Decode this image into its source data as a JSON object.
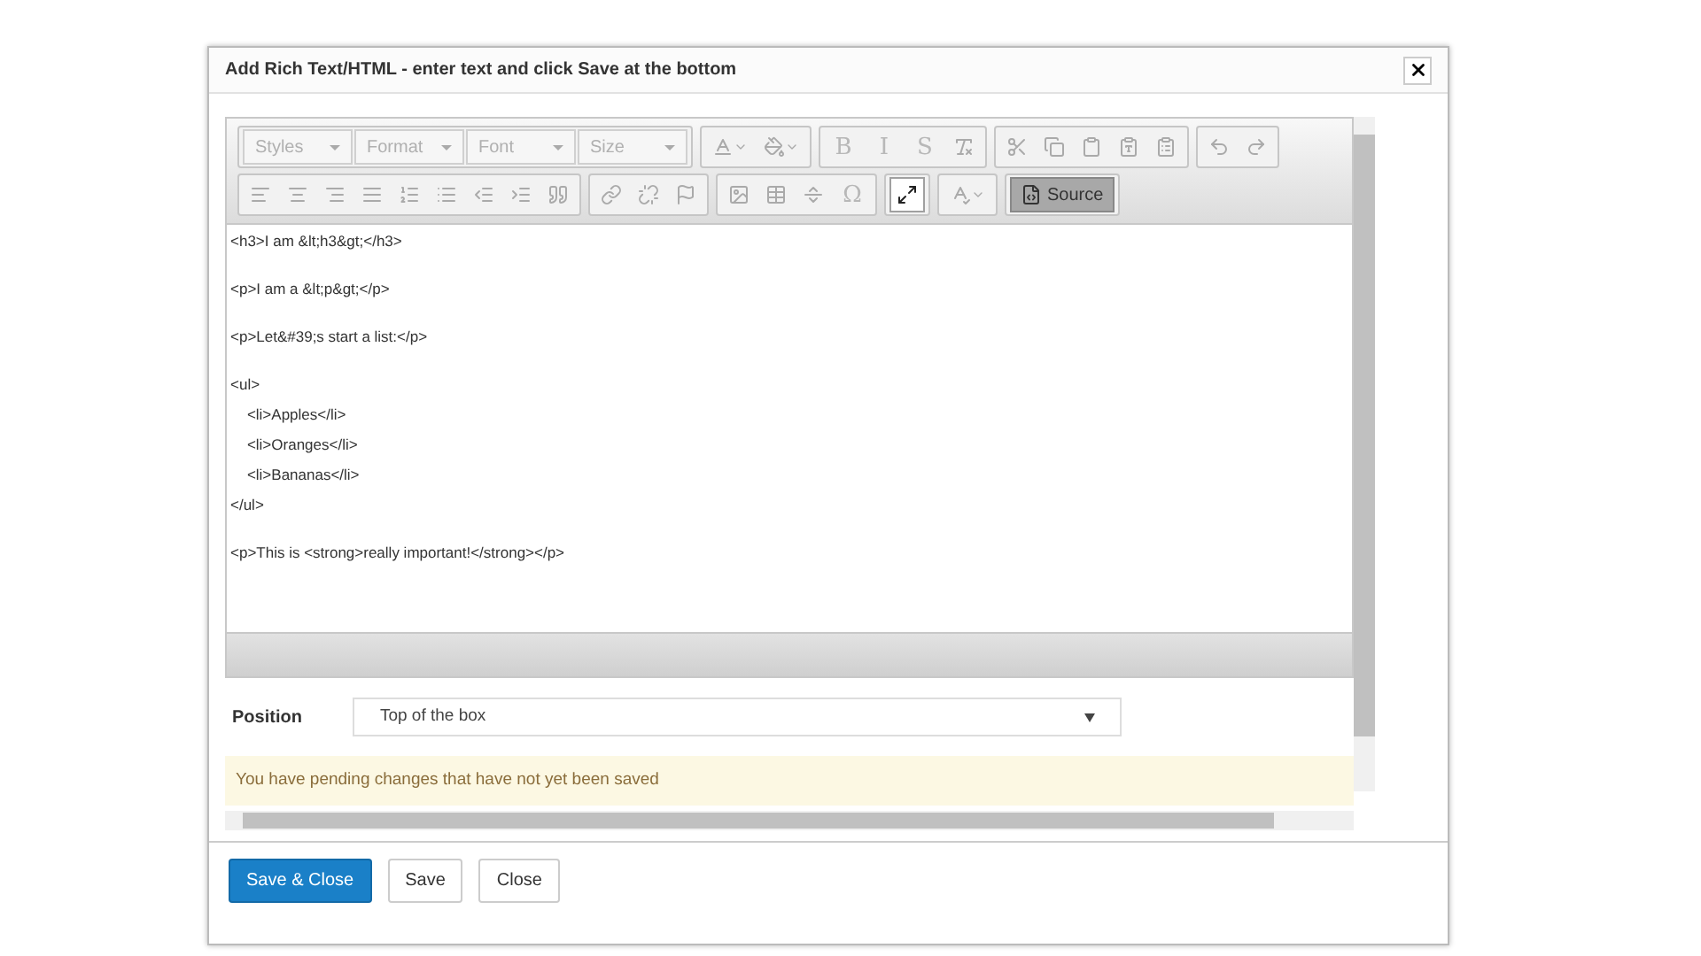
{
  "dialog": {
    "title": "Add Rich Text/HTML - enter text and click Save at the bottom"
  },
  "toolbar": {
    "rows": [
      [
        [
          {
            "kind": "combo",
            "label": "Styles"
          },
          {
            "kind": "combo",
            "label": "Format"
          },
          {
            "kind": "combo",
            "label": "Font"
          },
          {
            "kind": "combo",
            "label": "Size"
          }
        ],
        [
          {
            "kind": "icon",
            "on": false
          },
          {
            "kind": "icon",
            "on": false
          }
        ],
        [
          {
            "kind": "text",
            "label": "B",
            "on": false
          },
          {
            "kind": "text",
            "label": "I",
            "on": false
          },
          {
            "kind": "text",
            "label": "S",
            "on": false
          },
          {
            "kind": "icon",
            "on": false
          }
        ],
        [
          {
            "kind": "icon",
            "on": false
          },
          {
            "kind": "icon",
            "on": false
          },
          {
            "kind": "icon",
            "on": false
          },
          {
            "kind": "icon",
            "on": false
          },
          {
            "kind": "icon",
            "on": false
          }
        ],
        [
          {
            "kind": "icon",
            "on": false
          },
          {
            "kind": "icon",
            "on": false
          }
        ]
      ],
      [
        [
          {
            "kind": "icon",
            "on": false
          },
          {
            "kind": "icon",
            "on": false
          },
          {
            "kind": "icon",
            "on": false
          },
          {
            "kind": "icon",
            "on": false
          },
          {
            "kind": "icon",
            "on": false
          },
          {
            "kind": "icon",
            "on": false
          },
          {
            "kind": "icon",
            "on": false
          },
          {
            "kind": "icon",
            "on": false
          },
          {
            "kind": "icon",
            "on": false
          }
        ],
        [
          {
            "kind": "icon",
            "on": false
          },
          {
            "kind": "icon",
            "on": false
          },
          {
            "kind": "icon",
            "on": false
          }
        ],
        [
          {
            "kind": "icon",
            "on": false
          },
          {
            "kind": "icon",
            "on": false
          },
          {
            "kind": "icon",
            "on": false
          },
          {
            "kind": "text",
            "label": "Ω",
            "on": false
          }
        ],
        [
          {
            "kind": "icon",
            "on": true
          }
        ],
        [
          {
            "kind": "icon",
            "on": false
          }
        ],
        [
          {
            "kind": "source",
            "label": "Source",
            "on": true
          }
        ]
      ]
    ]
  },
  "source_blocks": [
    [
      "<h3>I am &lt;h3&gt;</h3>"
    ],
    [
      "<p>I am a &lt;p&gt;</p>"
    ],
    [
      "<p>Let&#39;s start a list:</p>"
    ],
    [
      "<ul>",
      "    <li>Apples</li>",
      "    <li>Oranges</li>",
      "    <li>Bananas</li>",
      "</ul>"
    ],
    [
      "<p>This is <strong>really important!</strong></p>"
    ]
  ],
  "position": {
    "label": "Position",
    "value": "Top of the box"
  },
  "notice": "You have pending changes that have not yet been saved",
  "buttons": [
    {
      "label": "Save & Close",
      "primary": true
    },
    {
      "label": "Save",
      "primary": false
    },
    {
      "label": "Close",
      "primary": false
    }
  ]
}
